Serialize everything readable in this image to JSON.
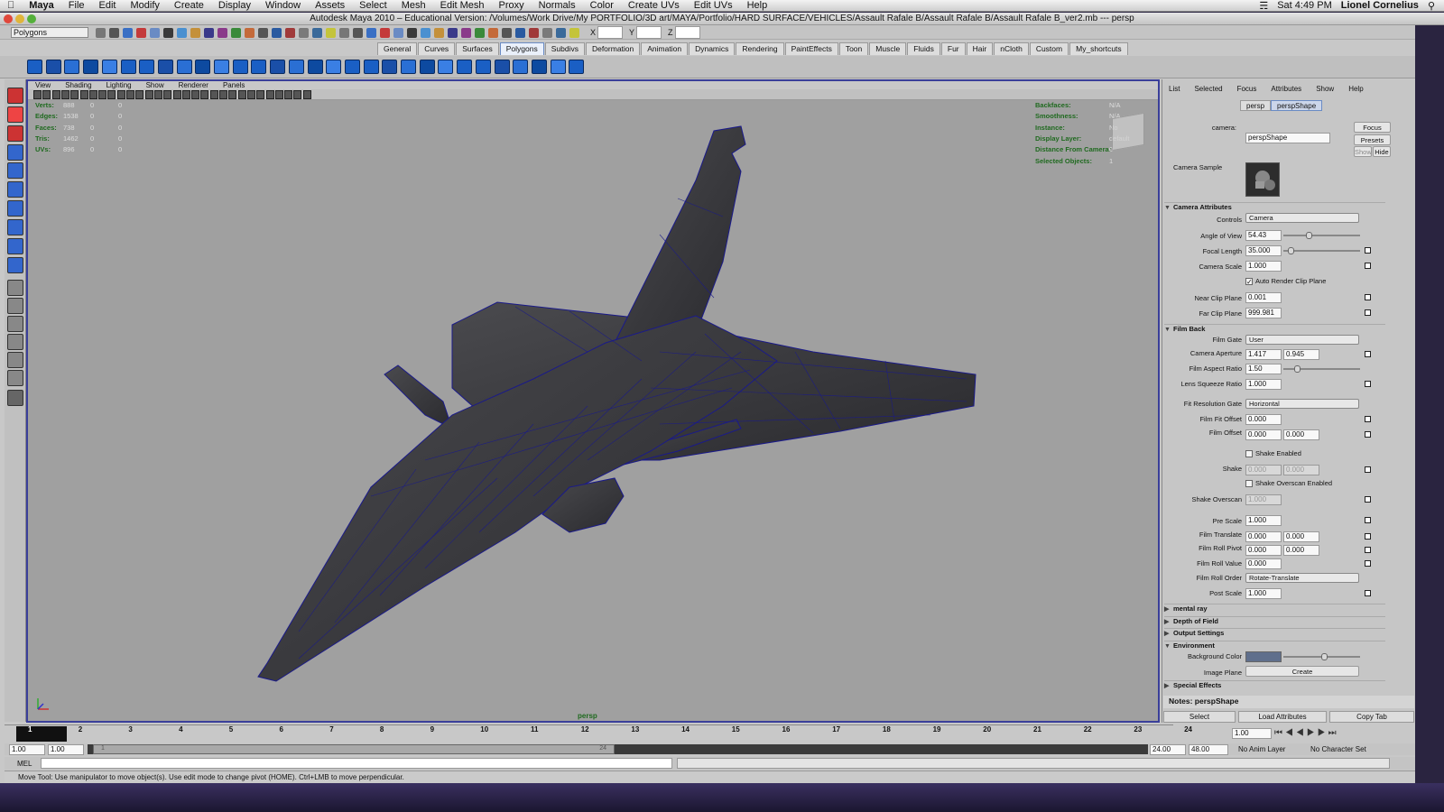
{
  "macmenu": {
    "app": "Maya",
    "items": [
      "File",
      "Edit",
      "Modify",
      "Create",
      "Display",
      "Window",
      "Assets",
      "Select",
      "Mesh",
      "Edit Mesh",
      "Proxy",
      "Normals",
      "Color",
      "Create UVs",
      "Edit UVs",
      "Help"
    ],
    "clock": "Sat 4:49 PM",
    "user": "Lionel Cornelius"
  },
  "window_title": "Autodesk Maya 2010 – Educational Version: /Volumes/Work Drive/My PORTFOLIO/3D art/MAYA/Portfolio/HARD SURFACE/VEHICLES/Assault Rafale B/Assault Rafale B/Assault Rafale B_ver2.mb  ---  persp",
  "mode_menu": "Polygons",
  "xyz": [
    "X",
    "Y",
    "Z"
  ],
  "shelf_tabs": [
    "General",
    "Curves",
    "Surfaces",
    "Polygons",
    "Subdivs",
    "Deformation",
    "Animation",
    "Dynamics",
    "Rendering",
    "PaintEffects",
    "Toon",
    "Muscle",
    "Fluids",
    "Fur",
    "Hair",
    "nCloth",
    "Custom",
    "My_shortcuts"
  ],
  "active_shelf_tab": "Polygons",
  "viewport": {
    "menu": [
      "View",
      "Shading",
      "Lighting",
      "Show",
      "Renderer",
      "Panels"
    ],
    "camera": "persp",
    "hud_left": [
      {
        "label": "Verts:",
        "a": "888",
        "b": "0",
        "c": "0"
      },
      {
        "label": "Edges:",
        "a": "1538",
        "b": "0",
        "c": "0"
      },
      {
        "label": "Faces:",
        "a": "738",
        "b": "0",
        "c": "0"
      },
      {
        "label": "Tris:",
        "a": "1462",
        "b": "0",
        "c": "0"
      },
      {
        "label": "UVs:",
        "a": "896",
        "b": "0",
        "c": "0"
      }
    ],
    "hud_right": [
      {
        "label": "Backfaces:",
        "value": "N/A"
      },
      {
        "label": "Smoothness:",
        "value": "N/A"
      },
      {
        "label": "Instance:",
        "value": "No"
      },
      {
        "label": "Display Layer:",
        "value": "default"
      },
      {
        "label": "Distance From Camera:",
        "value": "0"
      },
      {
        "label": "Selected Objects:",
        "value": "1"
      }
    ]
  },
  "attribute_editor": {
    "menu": [
      "List",
      "Selected",
      "Focus",
      "Attributes",
      "Show",
      "Help"
    ],
    "tabs": [
      "persp",
      "perspShape"
    ],
    "active_tab": "perspShape",
    "camera_label": "camera:",
    "camera_value": "perspShape",
    "buttons": {
      "focus": "Focus",
      "presets": "Presets",
      "show": "Show",
      "hide": "Hide"
    },
    "camera_sample": "Camera Sample",
    "sections": {
      "camera_attributes": "Camera Attributes",
      "film_back": "Film Back",
      "mental_ray": "mental ray",
      "depth_of_field": "Depth of Field",
      "output_settings": "Output Settings",
      "environment": "Environment",
      "special_effects": "Special Effects"
    },
    "camera_attrs": {
      "controls_label": "Controls",
      "controls": "Camera",
      "angle_of_view_label": "Angle of View",
      "angle_of_view": "54.43",
      "focal_length_label": "Focal Length",
      "focal_length": "35.000",
      "camera_scale_label": "Camera Scale",
      "camera_scale": "1.000",
      "auto_clip_label": "Auto Render Clip Plane",
      "near_clip_label": "Near Clip Plane",
      "near_clip": "0.001",
      "far_clip_label": "Far Clip Plane",
      "far_clip": "999.981"
    },
    "film_back": {
      "film_gate_label": "Film Gate",
      "film_gate": "User",
      "aperture_label": "Camera Aperture",
      "aperture_x": "1.417",
      "aperture_y": "0.945",
      "aspect_label": "Film Aspect Ratio",
      "aspect": "1.50",
      "lens_squeeze_label": "Lens Squeeze Ratio",
      "lens_squeeze": "1.000",
      "fit_gate_label": "Fit Resolution Gate",
      "fit_gate": "Horizontal",
      "fit_offset_label": "Film Fit Offset",
      "fit_offset": "0.000",
      "film_offset_label": "Film Offset",
      "film_offset_x": "0.000",
      "film_offset_y": "0.000",
      "shake_enabled_label": "Shake Enabled",
      "shake_label": "Shake",
      "shake_x": "0.000",
      "shake_y": "0.000",
      "shake_overscan_enabled_label": "Shake Overscan Enabled",
      "shake_overscan_label": "Shake Overscan",
      "shake_overscan": "1.000",
      "pre_scale_label": "Pre Scale",
      "pre_scale": "1.000",
      "film_translate_label": "Film Translate",
      "film_translate_x": "0.000",
      "film_translate_y": "0.000",
      "roll_pivot_label": "Film Roll Pivot",
      "roll_pivot_x": "0.000",
      "roll_pivot_y": "0.000",
      "roll_value_label": "Film Roll Value",
      "roll_value": "0.000",
      "roll_order_label": "Film Roll Order",
      "roll_order": "Rotate-Translate",
      "post_scale_label": "Post Scale",
      "post_scale": "1.000"
    },
    "environment": {
      "bg_color_label": "Background Color",
      "bg_color": "#5f6f8c",
      "image_plane_label": "Image Plane",
      "image_plane_btn": "Create"
    },
    "notes": "Notes:  perspShape",
    "bottom": [
      "Select",
      "Load Attributes",
      "Copy Tab"
    ]
  },
  "timeline": {
    "ticks": [
      "1",
      "2",
      "3",
      "4",
      "5",
      "6",
      "7",
      "8",
      "9",
      "10",
      "11",
      "12",
      "13",
      "14",
      "15",
      "16",
      "17",
      "18",
      "19",
      "20",
      "21",
      "22",
      "23",
      "24"
    ],
    "current_frame": "1.00",
    "range_start": "1.00",
    "range_inner_start": "1.00",
    "range_end_inner": "24.00",
    "range_end": "48.00",
    "slider_start_label": "1",
    "slider_end_label": "24",
    "anim_layer": "No Anim Layer",
    "char_set": "No Character Set"
  },
  "command_line": {
    "label": "MEL"
  },
  "help_line": "Move Tool: Use manipulator to move object(s). Use edit mode to change pivot (HOME).  Ctrl+LMB to move perpendicular."
}
